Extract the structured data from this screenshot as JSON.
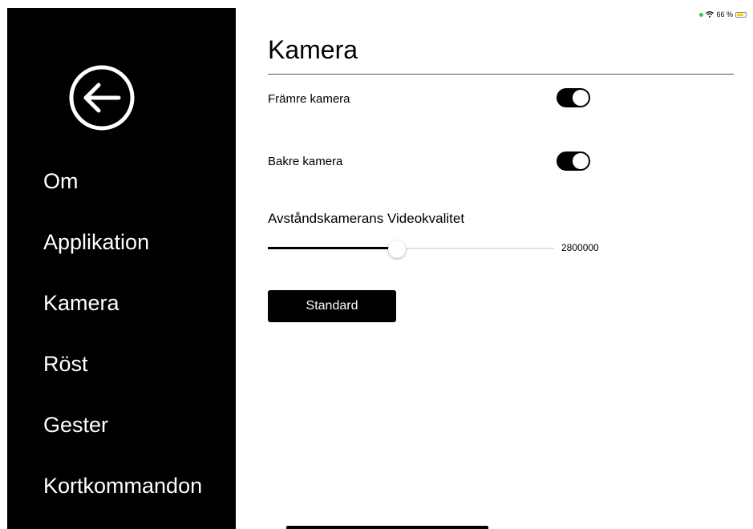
{
  "status_bar": {
    "battery_text": "66 %",
    "dot_color": "#34c759"
  },
  "sidebar": {
    "back_icon": "arrow-left-circle-icon",
    "items": [
      {
        "label": "Om"
      },
      {
        "label": "Applikation"
      },
      {
        "label": "Kamera"
      },
      {
        "label": "Röst"
      },
      {
        "label": "Gester"
      },
      {
        "label": "Kortkommandon"
      }
    ]
  },
  "main": {
    "title": "Kamera",
    "settings": [
      {
        "label": "Främre kamera",
        "on": true
      },
      {
        "label": "Bakre kamera",
        "on": true
      }
    ],
    "video_quality": {
      "label": "Avståndskamerans Videokvalitet",
      "value_text": "2800000",
      "fraction": 0.45
    },
    "standard_button": "Standard"
  }
}
